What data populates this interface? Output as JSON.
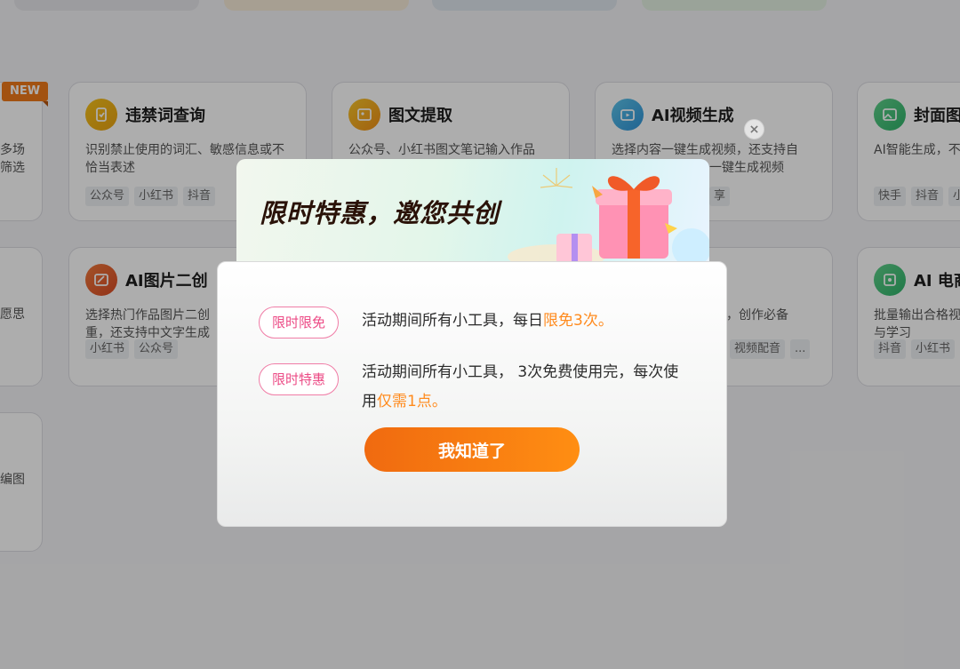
{
  "background": {
    "new_badge": "NEW",
    "left_fragments": [
      "多场",
      "筛选",
      "愿思",
      "编图"
    ],
    "cards": [
      {
        "title": "违禁词查询",
        "icon": "document-check-icon",
        "desc": "识别禁止使用的词汇、敏感信息或不恰当表述",
        "tags": [
          "公众号",
          "小红书",
          "抖音"
        ]
      },
      {
        "title": "图文提取",
        "icon": "image-extract-icon",
        "desc": "公众号、小红书图文笔记输入作品",
        "tags": []
      },
      {
        "title": "AI视频生成",
        "icon": "video-play-icon",
        "desc": "选择内容一键生成视频，还支持自",
        "desc_fragment": "一键生成视频",
        "tags": [
          "享"
        ]
      },
      {
        "title": "封面图",
        "icon": "image-icon",
        "desc": "AI智能生成，不",
        "tags": [
          "快手",
          "抖音",
          "小"
        ]
      },
      {
        "title": "AI图片二创",
        "icon": "image-edit-icon",
        "desc": "选择热门作品图片二创重，还支持中文字生成",
        "desc_line1": "选择热门作品图片二创",
        "desc_line2": "重，还支持中文字生成",
        "tags": [
          "小红书",
          "公众号"
        ]
      },
      {
        "title": "",
        "icon": "",
        "desc": "，创作必备",
        "tags": [
          "视频配音",
          "..."
        ]
      },
      {
        "title": "AI 电商",
        "icon": "shop-image-icon",
        "desc": "批量输出合格视与学习",
        "desc_line1": "批量输出合格视",
        "desc_line2": "与学习",
        "tags": [
          "抖音",
          "小红书"
        ]
      }
    ]
  },
  "modal": {
    "banner_title": "限时特惠，邀您共创",
    "rows": [
      {
        "badge": "限时限免",
        "text_before": "活动期间所有小工具，每日",
        "highlight": "限免3次。"
      },
      {
        "badge": "限时特惠",
        "text_before": "活动期间所有小工具， 3次免费使用完，每次使用",
        "highlight": "仅需1点。"
      }
    ],
    "confirm_label": "我知道了",
    "close_icon": "close-icon"
  },
  "colors": {
    "accent": "#ff8a1c",
    "badge_pink": "#ec4b86",
    "button_start": "#f06a10",
    "button_end": "#ff8e12"
  }
}
